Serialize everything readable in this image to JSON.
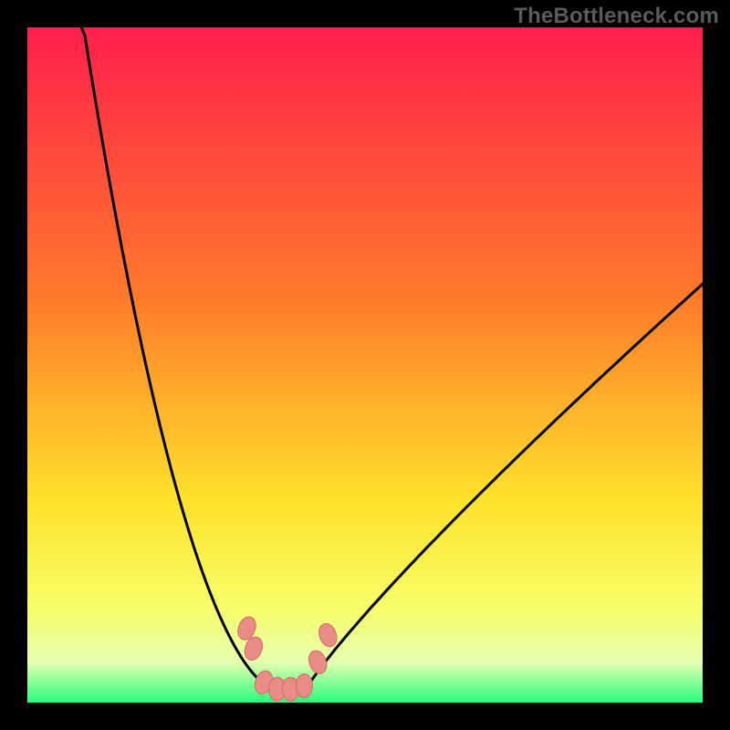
{
  "credit": "TheBottleneck.com",
  "colors": {
    "frame": "#000000",
    "gradient_top": "#ff1f4b",
    "gradient_mid1": "#ff7a2a",
    "gradient_mid2": "#ffe22a",
    "gradient_low1": "#f7ff6a",
    "gradient_low2": "#e6ffb0",
    "gradient_bottom": "#26ff7a",
    "curve": "#000000",
    "marker_fill": "#e98b86",
    "marker_stroke": "#d46a64"
  },
  "chart_data": {
    "type": "line",
    "title": "",
    "xlabel": "",
    "ylabel": "",
    "xlim": [
      0,
      100
    ],
    "ylim": [
      0,
      100
    ],
    "series": [
      {
        "name": "bottleneck-curve",
        "x_min_at": 38,
        "y_at_edges_left": 100,
        "y_at_edges_right": 62
      }
    ],
    "markers": [
      {
        "x": 32.5,
        "y": 11
      },
      {
        "x": 33.5,
        "y": 8
      },
      {
        "x": 35.0,
        "y": 3
      },
      {
        "x": 37.0,
        "y": 2
      },
      {
        "x": 39.0,
        "y": 2
      },
      {
        "x": 41.0,
        "y": 2.5
      },
      {
        "x": 43.0,
        "y": 6
      },
      {
        "x": 44.5,
        "y": 10
      }
    ]
  }
}
